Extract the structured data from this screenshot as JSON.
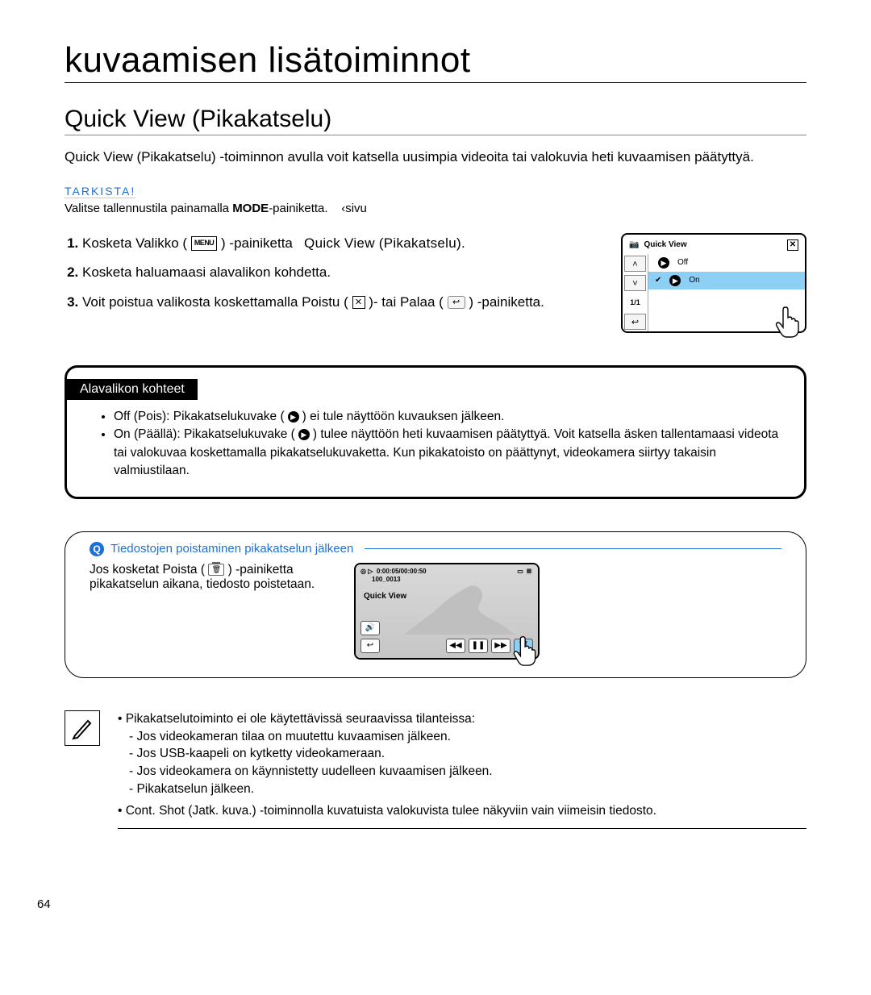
{
  "page_number": "64",
  "title": "kuvaamisen lisätoiminnot",
  "section_title": "Quick View (Pikakatselu)",
  "intro": "Quick View (Pikakatselu) -toiminnon avulla voit katsella uusimpia videoita tai valokuvia heti kuvaamisen päätyttyä.",
  "check_label": "TARKISTA!",
  "check_body_1": "Valitse tallennustila painamalla ",
  "check_mode": "MODE",
  "check_body_2": "-painiketta.",
  "check_ref": "‹sivu",
  "steps": {
    "s1a": "Kosketa Valikko (",
    "s1b": ") -painiketta",
    "s1c": "Quick View (Pikakatselu).",
    "s2": "Kosketa haluamaasi alavalikon kohdetta.",
    "s3a": "Voit poistua valikosta koskettamalla Poistu (",
    "s3b": ")- tai Palaa (",
    "s3c": ") -painiketta."
  },
  "device": {
    "title": "Quick View",
    "opt_off": "Off",
    "opt_on": "On",
    "page": "1/1"
  },
  "submenu": {
    "header": "Alavalikon kohteet",
    "off_a": "Off (Pois): Pikakatselukuvake (",
    "off_b": ") ei tule näyttöön kuvauksen jälkeen.",
    "on_a": "On (Päällä): Pikakatselukuvake (",
    "on_b": ") tulee näyttöön heti kuvaamisen päätyttyä. Voit katsella äsken tallentamaasi videota tai valokuvaa koskettamalla pikakatselukuvaketta. Kun pikakatoisto on päättynyt, videokamera siirtyy takaisin valmiustilaan."
  },
  "tip": {
    "title": "Tiedostojen poistaminen pikakatselun jälkeen",
    "body_a": "Jos kosketat Poista (",
    "body_b": ") -painiketta pikakatselun aikana, tiedosto poistetaan."
  },
  "playback": {
    "time": "0:00:05/00:00:50",
    "file": "100_0013",
    "label": "Quick View"
  },
  "notes": {
    "a": "Pikakatselutoiminto ei ole käytettävissä seuraavissa tilanteissa:",
    "b1": "- Jos videokameran tilaa on muutettu kuvaamisen jälkeen.",
    "b2": "- Jos USB-kaapeli on kytketty videokameraan.",
    "b3": "- Jos videokamera on käynnistetty uudelleen kuvaamisen jälkeen.",
    "b4": "- Pikakatselun jälkeen.",
    "c_pre": "Cont. Shot (Jatk. kuva.)",
    "c": " -toiminnolla kuvatuista valokuvista tulee näkyviin vain viimeisin tiedosto."
  }
}
